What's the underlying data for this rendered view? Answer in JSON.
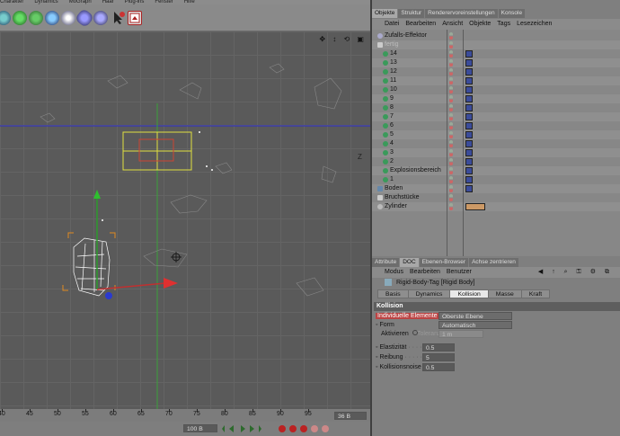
{
  "menubar": [
    "Charakter",
    "Dynamics",
    "MoGraph",
    "Haar",
    "Plug-ins",
    "Fenster",
    "Hilfe"
  ],
  "viewport": {
    "axis_label": "Z",
    "colors": {
      "bg": "#5a5a5a",
      "grid": "#646464",
      "horizon": "#2b2bcc",
      "vertical": "#3aa03a",
      "selection": "#e0e040"
    }
  },
  "timeline": {
    "ticks": [
      "40",
      "45",
      "50",
      "55",
      "60",
      "65",
      "70",
      "75",
      "80",
      "85",
      "90",
      "95"
    ],
    "field_frames": "100 B",
    "field_current": "36 B"
  },
  "object_manager": {
    "tabs": [
      "Objekte",
      "Struktur",
      "Renderervoreinstellungen",
      "Konsole"
    ],
    "active_tab": 0,
    "menu": [
      "Datei",
      "Bearbeiten",
      "Ansicht",
      "Objekte",
      "Tags",
      "Lesezeichen"
    ],
    "rows": [
      {
        "name": "Zufalls-Effektor",
        "indent": 14,
        "icon": "effector",
        "dots": true,
        "tag": false
      },
      {
        "name": "fertig",
        "indent": 14,
        "icon": "null",
        "dots": true,
        "tag": false
      },
      {
        "name": "14",
        "indent": 20,
        "icon": "mesh",
        "dots": true,
        "tag": true
      },
      {
        "name": "13",
        "indent": 20,
        "icon": "mesh",
        "dots": true,
        "tag": true
      },
      {
        "name": "12",
        "indent": 20,
        "icon": "mesh",
        "dots": true,
        "tag": true
      },
      {
        "name": "11",
        "indent": 20,
        "icon": "mesh",
        "dots": true,
        "tag": true
      },
      {
        "name": "10",
        "indent": 20,
        "icon": "mesh",
        "dots": true,
        "tag": true
      },
      {
        "name": "9",
        "indent": 20,
        "icon": "mesh",
        "dots": true,
        "tag": true
      },
      {
        "name": "8",
        "indent": 20,
        "icon": "mesh",
        "dots": true,
        "tag": true
      },
      {
        "name": "7",
        "indent": 20,
        "icon": "mesh",
        "dots": true,
        "tag": true
      },
      {
        "name": "6",
        "indent": 20,
        "icon": "mesh",
        "dots": true,
        "tag": true
      },
      {
        "name": "5",
        "indent": 20,
        "icon": "mesh",
        "dots": true,
        "tag": true
      },
      {
        "name": "4",
        "indent": 20,
        "icon": "mesh",
        "dots": true,
        "tag": true
      },
      {
        "name": "3",
        "indent": 20,
        "icon": "mesh",
        "dots": true,
        "tag": true
      },
      {
        "name": "2",
        "indent": 20,
        "icon": "mesh",
        "dots": true,
        "tag": true
      },
      {
        "name": "Explosionsbereich",
        "indent": 20,
        "icon": "mesh",
        "dots": true,
        "tag": true
      },
      {
        "name": "1",
        "indent": 20,
        "icon": "mesh",
        "dots": true,
        "tag": true
      },
      {
        "name": "Boden",
        "indent": 14,
        "icon": "floor",
        "dots": true,
        "tag": true
      },
      {
        "name": "Bruchstücke",
        "indent": 14,
        "icon": "null",
        "dots": true,
        "tag": false
      },
      {
        "name": "Zylinder",
        "indent": 14,
        "icon": "cylinder",
        "dots": true,
        "tag": true
      }
    ]
  },
  "attribute_manager": {
    "tabs": [
      "Attribute",
      "DOC",
      "Ebenen-Browser",
      "Achse zentrieren"
    ],
    "active_tab": 1,
    "menu": [
      "Modus",
      "Bearbeiten",
      "Benutzer"
    ],
    "title": "Rigid-Body-Tag [Rigid Body]",
    "subtabs": [
      "Basis",
      "Dynamics",
      "Kollision",
      "Masse",
      "Kraft"
    ],
    "active_subtab": 2,
    "section": "Kollision",
    "props": {
      "individuelle_label": "Individuelle Elemente",
      "individuelle_value": "Oberste Ebene",
      "form_label": "Form",
      "form_value": "Automatisch",
      "aktivieren_label": "Aktivieren",
      "toleranz_label": "Toleranz",
      "toleranz_value": "1 m",
      "elastizitaet_label": "Elastizität",
      "elastizitaet_value": "0.5",
      "reibung_label": "Reibung",
      "reibung_value": "5",
      "rauschen_label": "Kollisionsnoise",
      "rauschen_value": "0.5"
    }
  }
}
